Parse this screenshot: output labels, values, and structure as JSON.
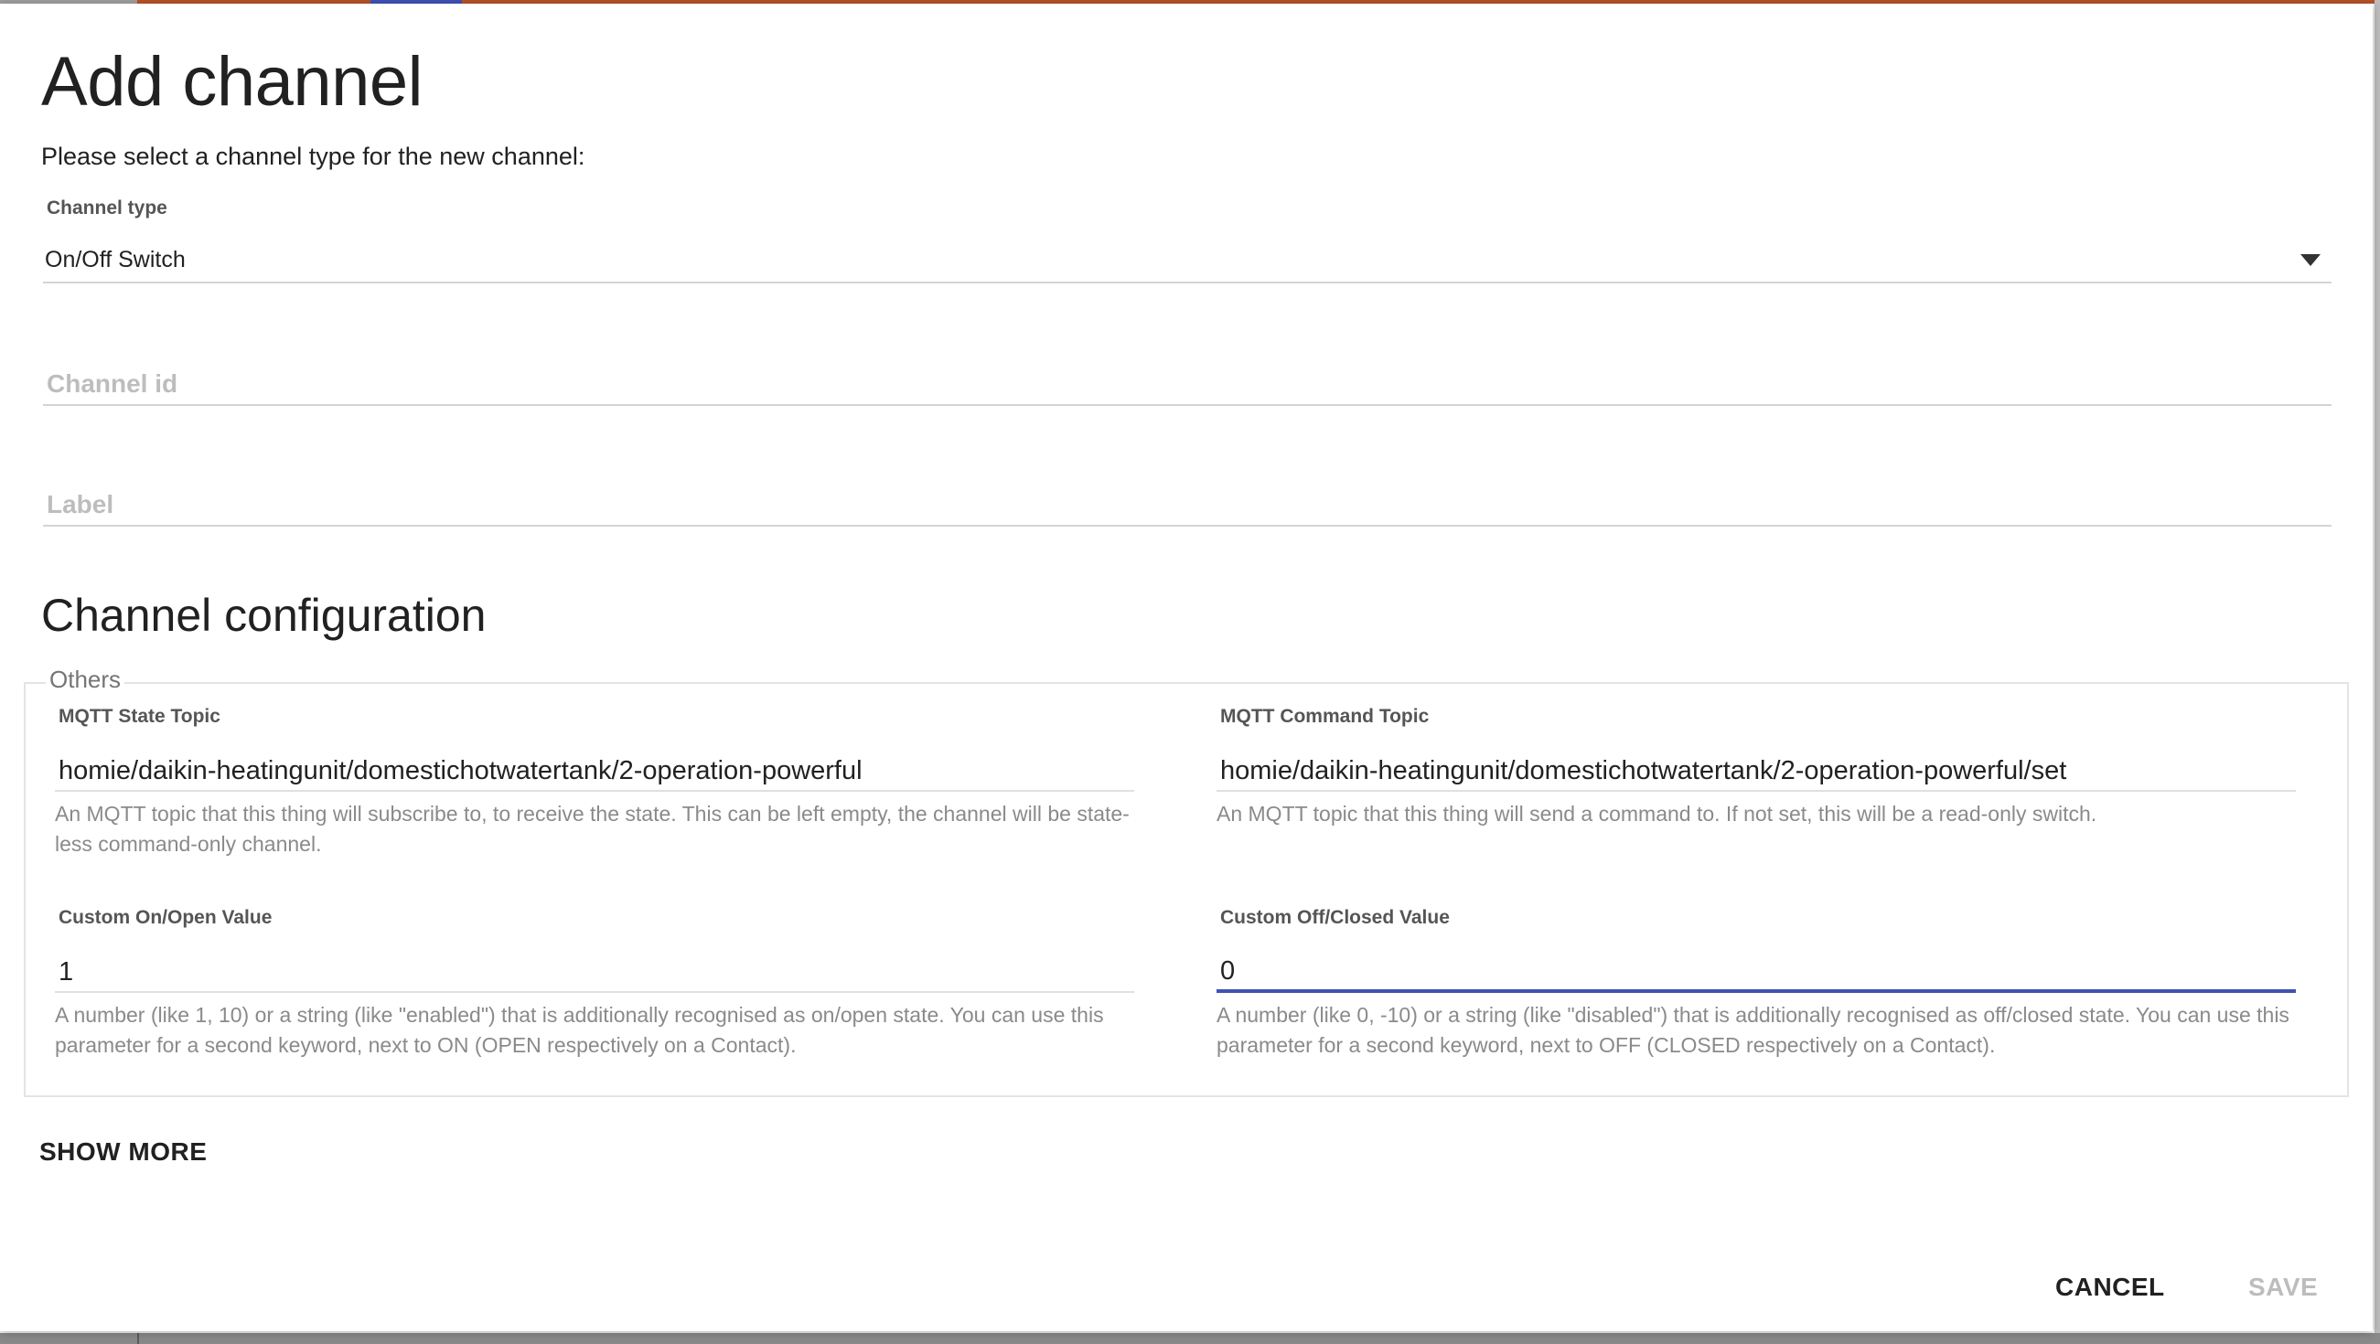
{
  "dialog": {
    "title": "Add channel",
    "subtitle": "Please select a channel type for the new channel:"
  },
  "channel_type": {
    "label": "Channel type",
    "value": "On/Off Switch"
  },
  "channel_id": {
    "placeholder": "Channel id",
    "value": ""
  },
  "label_field": {
    "placeholder": "Label",
    "value": ""
  },
  "config": {
    "title": "Channel configuration",
    "group_legend": "Others",
    "state_topic": {
      "label": "MQTT State Topic",
      "value": "homie/daikin-heatingunit/domestichotwatertank/2-operation-powerful",
      "hint": "An MQTT topic that this thing will subscribe to, to receive the state. This can be left empty, the channel will be state-less command-only channel."
    },
    "command_topic": {
      "label": "MQTT Command Topic",
      "value": "homie/daikin-heatingunit/domestichotwatertank/2-operation-powerful/set",
      "hint": "An MQTT topic that this thing will send a command to. If not set, this will be a read-only switch."
    },
    "on_value": {
      "label": "Custom On/Open Value",
      "value": "1",
      "hint": "A number (like 1, 10) or a string (like \"enabled\") that is additionally recognised as on/open state. You can use this parameter for a second keyword, next to ON (OPEN respectively on a Contact)."
    },
    "off_value": {
      "label": "Custom Off/Closed Value",
      "value": "0",
      "hint": "A number (like 0, -10) or a string (like \"disabled\") that is additionally recognised as off/closed state. You can use this parameter for a second keyword, next to OFF (CLOSED respectively on a Contact)."
    }
  },
  "actions": {
    "show_more": "SHOW MORE",
    "cancel": "CANCEL",
    "save": "SAVE"
  },
  "colors": {
    "accent": "#3f51b5",
    "topbar": "#b7522a",
    "hint_text": "#8a8a8a",
    "disabled": "#bdbdbd"
  }
}
